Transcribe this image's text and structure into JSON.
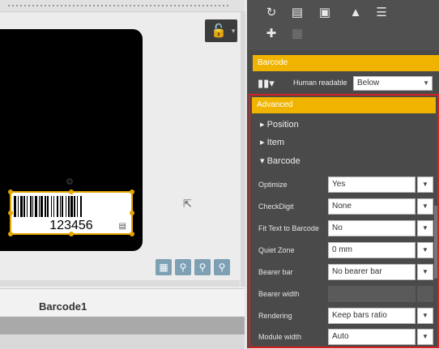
{
  "canvas": {
    "barcode_text": "123456",
    "lock_icon": "lock-icon",
    "zoom_icons": [
      "page-zoom-icon",
      "zoom-in-icon",
      "zoom-out-icon",
      "zoom-fit-icon"
    ]
  },
  "object_list": {
    "items": [
      {
        "name": "Barcode1"
      }
    ]
  },
  "panel": {
    "toolbar_icons": [
      "rotate-icon",
      "text-icon",
      "align-bottom-icon",
      "flip-icon",
      "align-left-icon",
      "arrange-icon",
      "group-icon"
    ],
    "barcode_header": "Barcode",
    "human_readable_label": "Human readable",
    "human_readable_value": "Below",
    "advanced_header": "Advanced",
    "sections": {
      "position": "Position",
      "item": "Item",
      "barcode": "Barcode"
    },
    "properties": [
      {
        "label": "Optimize",
        "value": "Yes",
        "enabled": true
      },
      {
        "label": "CheckDigit",
        "value": "None",
        "enabled": true
      },
      {
        "label": "Fit Text to Barcode",
        "value": "No",
        "enabled": true
      },
      {
        "label": "Quiet Zone",
        "value": "0 mm",
        "enabled": true
      },
      {
        "label": "Bearer bar",
        "value": "No bearer bar",
        "enabled": true
      },
      {
        "label": "Bearer width",
        "value": "",
        "enabled": false
      },
      {
        "label": "Rendering",
        "value": "Keep bars ratio",
        "enabled": true
      },
      {
        "label": "Module width",
        "value": "Auto",
        "enabled": true
      }
    ]
  },
  "colors": {
    "accent_yellow": "#f0b400",
    "highlight_red": "#d62020",
    "panel_bg": "#4a4a4a"
  }
}
